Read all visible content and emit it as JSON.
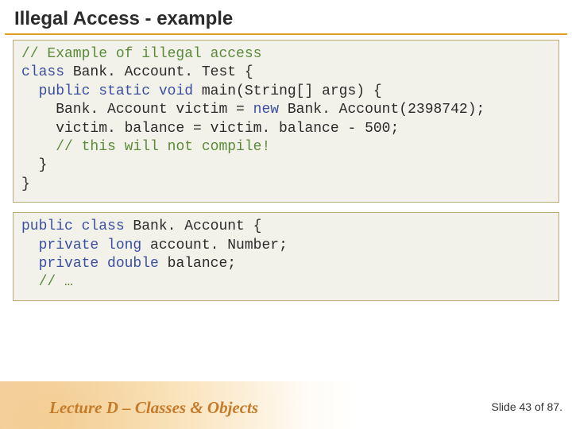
{
  "title": "Illegal Access - example",
  "code1": {
    "tokensByLine": [
      [
        [
          "com",
          "// Example of illegal access"
        ]
      ],
      [
        [
          "kw",
          "class"
        ],
        [
          "nm",
          " Bank. Account. Test {"
        ]
      ],
      [
        [
          "nm",
          "  "
        ],
        [
          "kw",
          "public static void"
        ],
        [
          "nm",
          " main(String[] args) {"
        ]
      ],
      [
        [
          "nm",
          "    Bank. Account victim = "
        ],
        [
          "kw",
          "new"
        ],
        [
          "nm",
          " Bank. Account(2398742);"
        ]
      ],
      [
        [
          "nm",
          "    victim. balance = victim. balance - 500;"
        ]
      ],
      [
        [
          "nm",
          "    "
        ],
        [
          "com",
          "// this will not compile!"
        ]
      ],
      [
        [
          "nm",
          "  }"
        ]
      ],
      [
        [
          "nm",
          "}"
        ]
      ]
    ]
  },
  "code2": {
    "tokensByLine": [
      [
        [
          "kw",
          "public class"
        ],
        [
          "nm",
          " Bank. Account {"
        ]
      ],
      [
        [
          "nm",
          "  "
        ],
        [
          "kw",
          "private long"
        ],
        [
          "nm",
          " account. Number;"
        ]
      ],
      [
        [
          "nm",
          "  "
        ],
        [
          "kw",
          "private double"
        ],
        [
          "nm",
          " balance;"
        ]
      ],
      [
        [
          "nm",
          "  "
        ],
        [
          "com",
          "// …"
        ]
      ]
    ]
  },
  "footer": {
    "lecture": "Lecture D – Classes & Objects",
    "slide": "Slide 43 of 87."
  }
}
